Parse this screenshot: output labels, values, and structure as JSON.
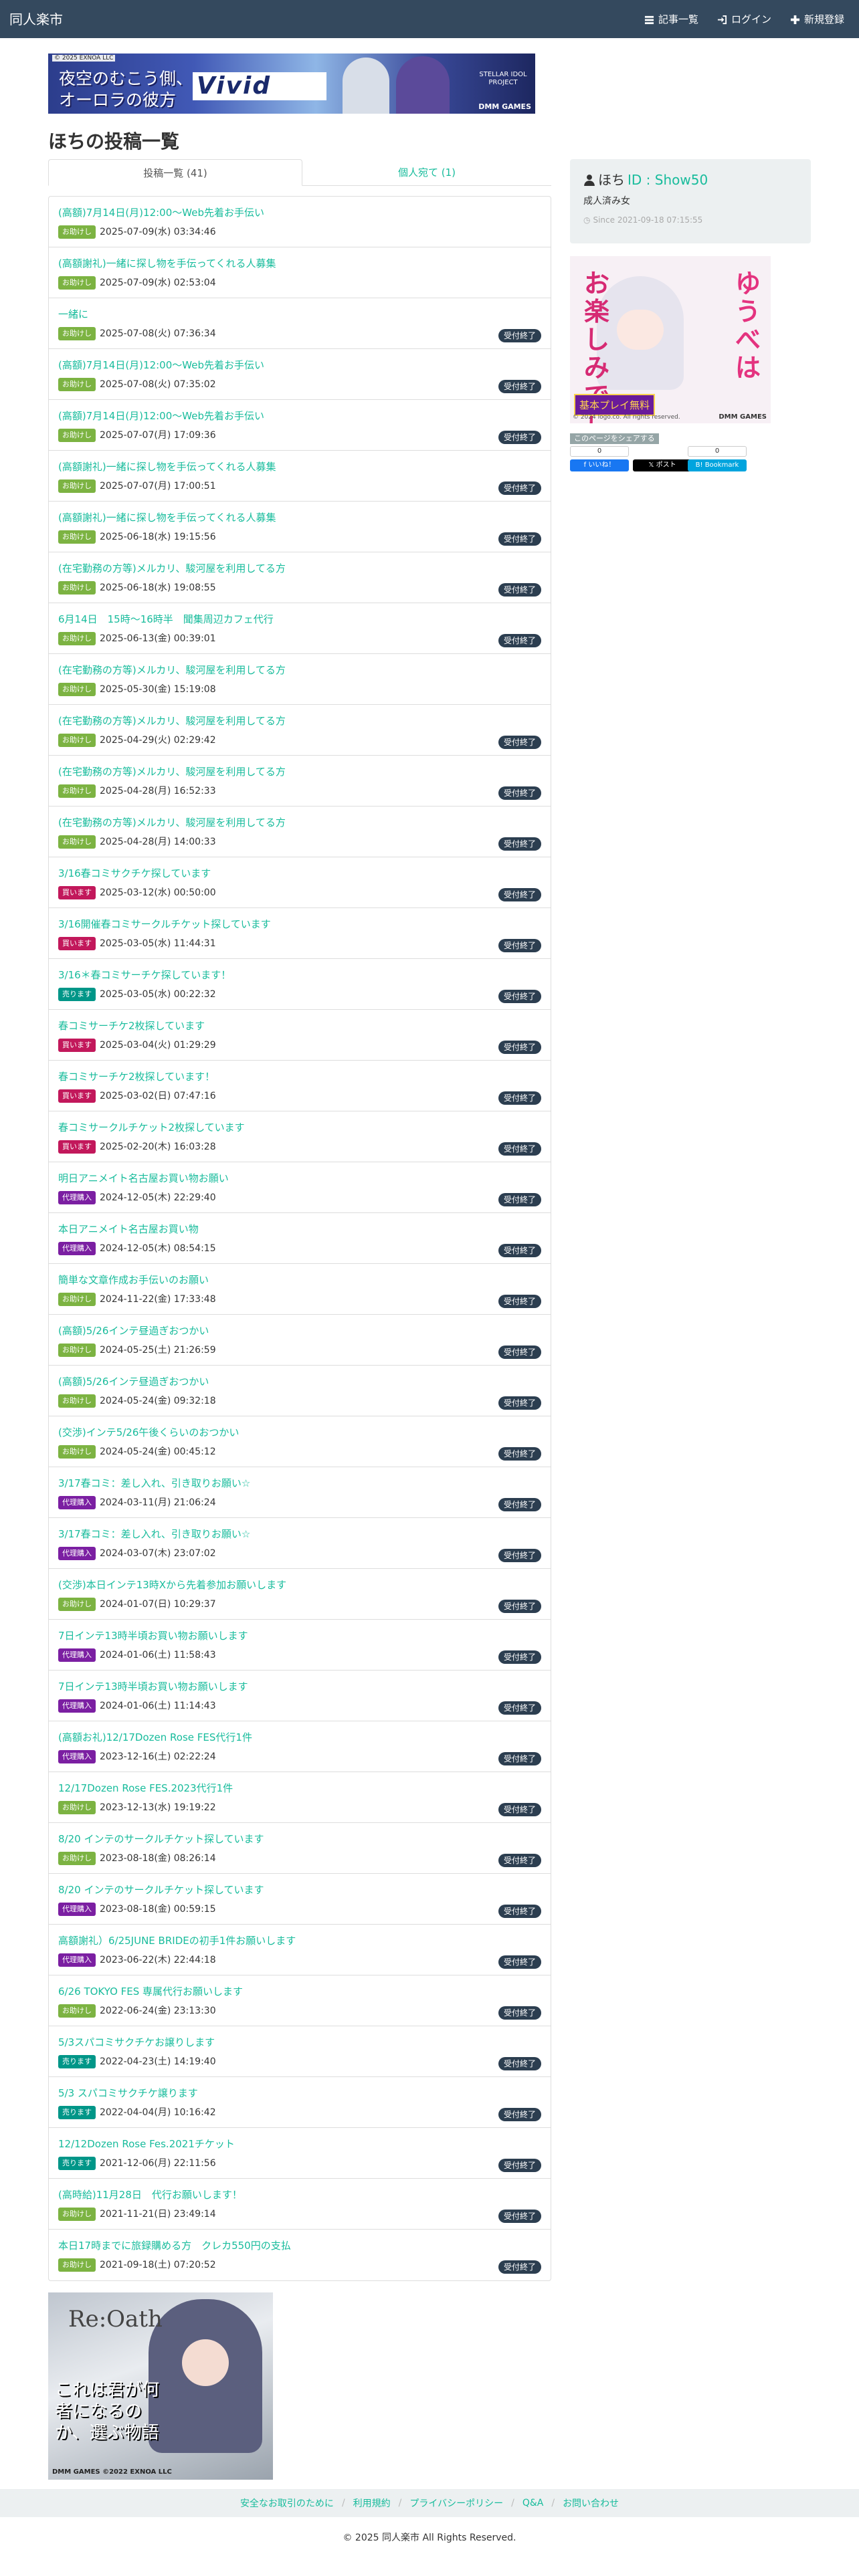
{
  "navbar": {
    "brand": "同人楽市",
    "links": [
      {
        "label": "記事一覧",
        "icon": "list-icon"
      },
      {
        "label": "ログイン",
        "icon": "login-icon"
      },
      {
        "label": "新規登録",
        "icon": "plus-icon"
      }
    ]
  },
  "banner_top": {
    "copyright": "© 2025 EXNOA LLC",
    "line1": "夜空のむこう側、",
    "line2": "オーロラの彼方",
    "logo": "Vivid",
    "project": "STELLAR IDOL PROJECT",
    "maker": "DMM GAMES"
  },
  "page_title": "ほちの投稿一覧",
  "tabs": [
    {
      "label": "投稿一覧 (41)",
      "active": true
    },
    {
      "label": "個人宛て (1)",
      "active": false
    }
  ],
  "posts": [
    {
      "title": "(高額)7月14日(月)12:00〜Web先着お手伝い",
      "category": "お助けし",
      "cat_color": "#7cb342",
      "date": "2025-07-09(水) 03:34:46",
      "status": ""
    },
    {
      "title": "(高額謝礼)一緒に探し物を手伝ってくれる人募集",
      "category": "お助けし",
      "cat_color": "#7cb342",
      "date": "2025-07-09(水) 02:53:04",
      "status": ""
    },
    {
      "title": "一緒に",
      "category": "お助けし",
      "cat_color": "#7cb342",
      "date": "2025-07-08(火) 07:36:34",
      "status": "受付終了"
    },
    {
      "title": "(高額)7月14日(月)12:00〜Web先着お手伝い",
      "category": "お助けし",
      "cat_color": "#7cb342",
      "date": "2025-07-08(火) 07:35:02",
      "status": "受付終了"
    },
    {
      "title": "(高額)7月14日(月)12:00〜Web先着お手伝い",
      "category": "お助けし",
      "cat_color": "#7cb342",
      "date": "2025-07-07(月) 17:09:36",
      "status": "受付終了"
    },
    {
      "title": "(高額謝礼)一緒に探し物を手伝ってくれる人募集",
      "category": "お助けし",
      "cat_color": "#7cb342",
      "date": "2025-07-07(月) 17:00:51",
      "status": "受付終了"
    },
    {
      "title": "(高額謝礼)一緒に探し物を手伝ってくれる人募集",
      "category": "お助けし",
      "cat_color": "#7cb342",
      "date": "2025-06-18(水) 19:15:56",
      "status": "受付終了"
    },
    {
      "title": "(在宅勤務の方等)メルカリ、駿河屋を利用してる方",
      "category": "お助けし",
      "cat_color": "#7cb342",
      "date": "2025-06-18(水) 19:08:55",
      "status": "受付終了"
    },
    {
      "title": "6月14日　15時〜16時半　聞集周辺カフェ代行",
      "category": "お助けし",
      "cat_color": "#7cb342",
      "date": "2025-06-13(金) 00:39:01",
      "status": "受付終了"
    },
    {
      "title": "(在宅勤務の方等)メルカリ、駿河屋を利用してる方",
      "category": "お助けし",
      "cat_color": "#7cb342",
      "date": "2025-05-30(金) 15:19:08",
      "status": ""
    },
    {
      "title": "(在宅勤務の方等)メルカリ、駿河屋を利用してる方",
      "category": "お助けし",
      "cat_color": "#7cb342",
      "date": "2025-04-29(火) 02:29:42",
      "status": "受付終了"
    },
    {
      "title": "(在宅勤務の方等)メルカリ、駿河屋を利用してる方",
      "category": "お助けし",
      "cat_color": "#7cb342",
      "date": "2025-04-28(月) 16:52:33",
      "status": "受付終了"
    },
    {
      "title": "(在宅勤務の方等)メルカリ、駿河屋を利用してる方",
      "category": "お助けし",
      "cat_color": "#7cb342",
      "date": "2025-04-28(月) 14:00:33",
      "status": "受付終了"
    },
    {
      "title": "3/16春コミサクチケ探しています",
      "category": "買います",
      "cat_color": "#c2185b",
      "date": "2025-03-12(水) 00:50:00",
      "status": "受付終了"
    },
    {
      "title": "3/16開催春コミサークルチケット探しています",
      "category": "買います",
      "cat_color": "#c2185b",
      "date": "2025-03-05(水) 11:44:31",
      "status": "受付終了"
    },
    {
      "title": "3/16＊春コミサーチケ探しています！",
      "category": "売ります",
      "cat_color": "#009688",
      "date": "2025-03-05(水) 00:22:32",
      "status": "受付終了"
    },
    {
      "title": "春コミサーチケ2枚探しています",
      "category": "買います",
      "cat_color": "#c2185b",
      "date": "2025-03-04(火) 01:29:29",
      "status": "受付終了"
    },
    {
      "title": "春コミサーチケ2枚探しています！",
      "category": "買います",
      "cat_color": "#c2185b",
      "date": "2025-03-02(日) 07:47:16",
      "status": "受付終了"
    },
    {
      "title": "春コミサークルチケット2枚探しています",
      "category": "買います",
      "cat_color": "#c2185b",
      "date": "2025-02-20(木) 16:03:28",
      "status": "受付終了"
    },
    {
      "title": "明日アニメイト名古屋お買い物お願い",
      "category": "代理購入",
      "cat_color": "#7b1fa2",
      "date": "2024-12-05(木) 22:29:40",
      "status": "受付終了"
    },
    {
      "title": "本日アニメイト名古屋お買い物",
      "category": "代理購入",
      "cat_color": "#7b1fa2",
      "date": "2024-12-05(木) 08:54:15",
      "status": "受付終了"
    },
    {
      "title": "簡単な文章作成お手伝いのお願い",
      "category": "お助けし",
      "cat_color": "#7cb342",
      "date": "2024-11-22(金) 17:33:48",
      "status": "受付終了"
    },
    {
      "title": "(高額)5/26インテ昼過ぎおつかい",
      "category": "お助けし",
      "cat_color": "#7cb342",
      "date": "2024-05-25(土) 21:26:59",
      "status": "受付終了"
    },
    {
      "title": "(高額)5/26インテ昼過ぎおつかい",
      "category": "お助けし",
      "cat_color": "#7cb342",
      "date": "2024-05-24(金) 09:32:18",
      "status": "受付終了"
    },
    {
      "title": "(交渉)インテ5/26午後くらいのおつかい",
      "category": "お助けし",
      "cat_color": "#7cb342",
      "date": "2024-05-24(金) 00:45:12",
      "status": "受付終了"
    },
    {
      "title": "3/17春コミ：差し入れ、引き取りお願い☆",
      "category": "代理購入",
      "cat_color": "#7b1fa2",
      "date": "2024-03-11(月) 21:06:24",
      "status": "受付終了"
    },
    {
      "title": "3/17春コミ：差し入れ、引き取りお願い☆",
      "category": "代理購入",
      "cat_color": "#7b1fa2",
      "date": "2024-03-07(木) 23:07:02",
      "status": "受付終了"
    },
    {
      "title": "(交渉)本日インテ13時Xから先着参加お願いします",
      "category": "お助けし",
      "cat_color": "#7cb342",
      "date": "2024-01-07(日) 10:29:37",
      "status": "受付終了"
    },
    {
      "title": "7日インテ13時半頃お買い物お願いします",
      "category": "代理購入",
      "cat_color": "#7b1fa2",
      "date": "2024-01-06(土) 11:58:43",
      "status": "受付終了"
    },
    {
      "title": "7日インテ13時半頃お買い物お願いします",
      "category": "代理購入",
      "cat_color": "#7b1fa2",
      "date": "2024-01-06(土) 11:14:43",
      "status": "受付終了"
    },
    {
      "title": "(高額お礼)12/17Dozen Rose FES代行1件",
      "category": "代理購入",
      "cat_color": "#7b1fa2",
      "date": "2023-12-16(土) 02:22:24",
      "status": "受付終了"
    },
    {
      "title": "12/17Dozen Rose FES.2023代行1件",
      "category": "お助けし",
      "cat_color": "#7cb342",
      "date": "2023-12-13(水) 19:19:22",
      "status": "受付終了"
    },
    {
      "title": "8/20 インテのサークルチケット探しています",
      "category": "お助けし",
      "cat_color": "#7cb342",
      "date": "2023-08-18(金) 08:26:14",
      "status": "受付終了"
    },
    {
      "title": "8/20 インテのサークルチケット探しています",
      "category": "代理購入",
      "cat_color": "#7b1fa2",
      "date": "2023-08-18(金) 00:59:15",
      "status": "受付終了"
    },
    {
      "title": "高額謝礼）6/25JUNE BRIDEの初手1件お願いします",
      "category": "代理購入",
      "cat_color": "#7b1fa2",
      "date": "2023-06-22(木) 22:44:18",
      "status": "受付終了"
    },
    {
      "title": "6/26 TOKYO FES 専属代行お願いします",
      "category": "お助けし",
      "cat_color": "#7cb342",
      "date": "2022-06-24(金) 23:13:30",
      "status": "受付終了"
    },
    {
      "title": "5/3スパコミサクチケお譲りします",
      "category": "売ります",
      "cat_color": "#009688",
      "date": "2022-04-23(土) 14:19:40",
      "status": "受付終了"
    },
    {
      "title": "5/3 スパコミサクチケ譲ります",
      "category": "売ります",
      "cat_color": "#009688",
      "date": "2022-04-04(月) 10:16:42",
      "status": "受付終了"
    },
    {
      "title": "12/12Dozen Rose Fes.2021チケット",
      "category": "売ります",
      "cat_color": "#009688",
      "date": "2021-12-06(月) 22:11:56",
      "status": "受付終了"
    },
    {
      "title": "(高時給)11月28日　代行お願いします！",
      "category": "お助けし",
      "cat_color": "#7cb342",
      "date": "2021-11-21(日) 23:49:14",
      "status": "受付終了"
    },
    {
      "title": "本日17時までに旅録購める方　クレカ550円の支払",
      "category": "お助けし",
      "cat_color": "#7cb342",
      "date": "2021-09-18(土) 07:20:52",
      "status": "受付終了"
    }
  ],
  "profile": {
    "name": "ほち",
    "id_label": "ID : Show50",
    "type": "成人済み女",
    "since": "Since 2021-09-18 07:15:55"
  },
  "side_ad": {
    "text1": "ゆうべは",
    "text2": "お楽しみでしたね",
    "cta": "基本プレイ無料",
    "foot": "© 2024 logo.co. All rights reserved.",
    "maker": "DMM GAMES"
  },
  "share": {
    "label": "このページをシェアする",
    "facebook": {
      "count": "0",
      "label": "いいね！"
    },
    "x": {
      "label": "ポスト"
    },
    "hatena": {
      "count": "0",
      "label": "B! Bookmark"
    }
  },
  "banner_bottom": {
    "logo": "Re:Oath",
    "copy": "これは君が何者になるのか、選ぶ物語",
    "maker": "DMM GAMES ©2022 EXNOA LLC"
  },
  "footer": {
    "links": [
      "安全なお取引のために",
      "利用規約",
      "プライバシーポリシー",
      "Q&A",
      "お問い合わせ"
    ],
    "copyright": "© 2025 同人楽市 All Rights Reserved."
  },
  "colors": {
    "navbar": "#34495e",
    "link": "#18bc9c",
    "status_badge": "#2c3e50"
  }
}
